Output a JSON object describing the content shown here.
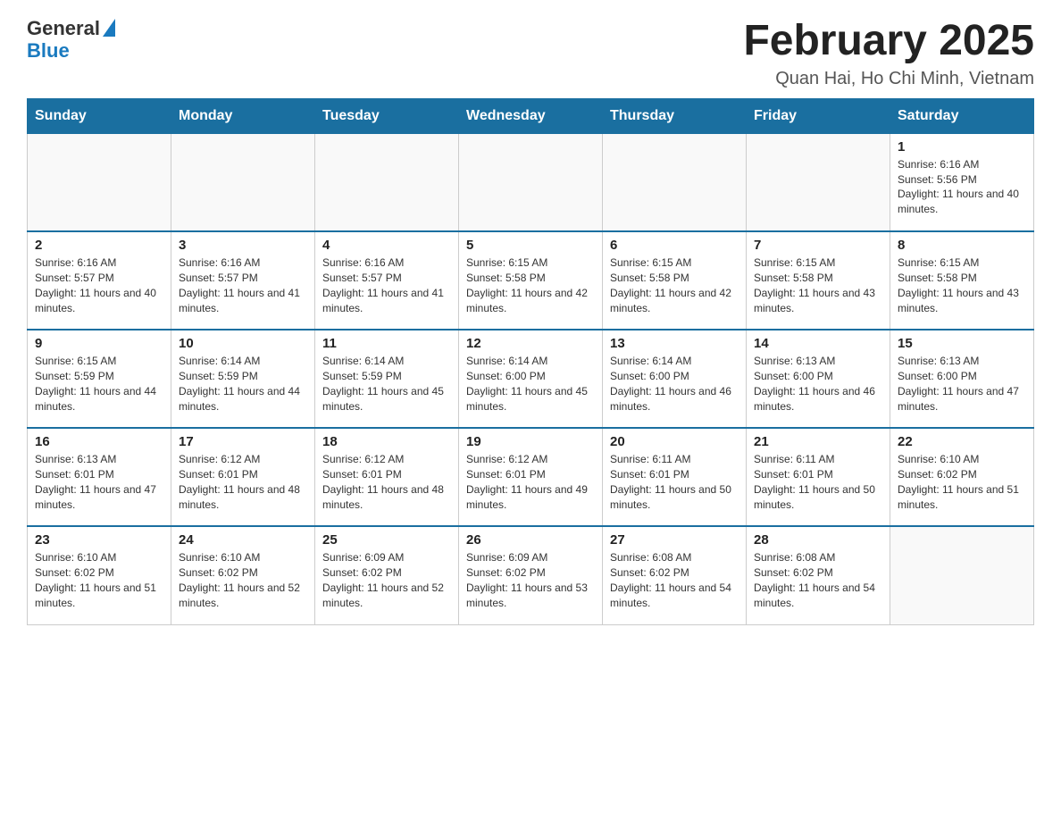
{
  "header": {
    "logo_general": "General",
    "logo_blue": "Blue",
    "title": "February 2025",
    "location": "Quan Hai, Ho Chi Minh, Vietnam"
  },
  "days_of_week": [
    "Sunday",
    "Monday",
    "Tuesday",
    "Wednesday",
    "Thursday",
    "Friday",
    "Saturday"
  ],
  "weeks": [
    [
      {
        "day": "",
        "info": ""
      },
      {
        "day": "",
        "info": ""
      },
      {
        "day": "",
        "info": ""
      },
      {
        "day": "",
        "info": ""
      },
      {
        "day": "",
        "info": ""
      },
      {
        "day": "",
        "info": ""
      },
      {
        "day": "1",
        "info": "Sunrise: 6:16 AM\nSunset: 5:56 PM\nDaylight: 11 hours and 40 minutes."
      }
    ],
    [
      {
        "day": "2",
        "info": "Sunrise: 6:16 AM\nSunset: 5:57 PM\nDaylight: 11 hours and 40 minutes."
      },
      {
        "day": "3",
        "info": "Sunrise: 6:16 AM\nSunset: 5:57 PM\nDaylight: 11 hours and 41 minutes."
      },
      {
        "day": "4",
        "info": "Sunrise: 6:16 AM\nSunset: 5:57 PM\nDaylight: 11 hours and 41 minutes."
      },
      {
        "day": "5",
        "info": "Sunrise: 6:15 AM\nSunset: 5:58 PM\nDaylight: 11 hours and 42 minutes."
      },
      {
        "day": "6",
        "info": "Sunrise: 6:15 AM\nSunset: 5:58 PM\nDaylight: 11 hours and 42 minutes."
      },
      {
        "day": "7",
        "info": "Sunrise: 6:15 AM\nSunset: 5:58 PM\nDaylight: 11 hours and 43 minutes."
      },
      {
        "day": "8",
        "info": "Sunrise: 6:15 AM\nSunset: 5:58 PM\nDaylight: 11 hours and 43 minutes."
      }
    ],
    [
      {
        "day": "9",
        "info": "Sunrise: 6:15 AM\nSunset: 5:59 PM\nDaylight: 11 hours and 44 minutes."
      },
      {
        "day": "10",
        "info": "Sunrise: 6:14 AM\nSunset: 5:59 PM\nDaylight: 11 hours and 44 minutes."
      },
      {
        "day": "11",
        "info": "Sunrise: 6:14 AM\nSunset: 5:59 PM\nDaylight: 11 hours and 45 minutes."
      },
      {
        "day": "12",
        "info": "Sunrise: 6:14 AM\nSunset: 6:00 PM\nDaylight: 11 hours and 45 minutes."
      },
      {
        "day": "13",
        "info": "Sunrise: 6:14 AM\nSunset: 6:00 PM\nDaylight: 11 hours and 46 minutes."
      },
      {
        "day": "14",
        "info": "Sunrise: 6:13 AM\nSunset: 6:00 PM\nDaylight: 11 hours and 46 minutes."
      },
      {
        "day": "15",
        "info": "Sunrise: 6:13 AM\nSunset: 6:00 PM\nDaylight: 11 hours and 47 minutes."
      }
    ],
    [
      {
        "day": "16",
        "info": "Sunrise: 6:13 AM\nSunset: 6:01 PM\nDaylight: 11 hours and 47 minutes."
      },
      {
        "day": "17",
        "info": "Sunrise: 6:12 AM\nSunset: 6:01 PM\nDaylight: 11 hours and 48 minutes."
      },
      {
        "day": "18",
        "info": "Sunrise: 6:12 AM\nSunset: 6:01 PM\nDaylight: 11 hours and 48 minutes."
      },
      {
        "day": "19",
        "info": "Sunrise: 6:12 AM\nSunset: 6:01 PM\nDaylight: 11 hours and 49 minutes."
      },
      {
        "day": "20",
        "info": "Sunrise: 6:11 AM\nSunset: 6:01 PM\nDaylight: 11 hours and 50 minutes."
      },
      {
        "day": "21",
        "info": "Sunrise: 6:11 AM\nSunset: 6:01 PM\nDaylight: 11 hours and 50 minutes."
      },
      {
        "day": "22",
        "info": "Sunrise: 6:10 AM\nSunset: 6:02 PM\nDaylight: 11 hours and 51 minutes."
      }
    ],
    [
      {
        "day": "23",
        "info": "Sunrise: 6:10 AM\nSunset: 6:02 PM\nDaylight: 11 hours and 51 minutes."
      },
      {
        "day": "24",
        "info": "Sunrise: 6:10 AM\nSunset: 6:02 PM\nDaylight: 11 hours and 52 minutes."
      },
      {
        "day": "25",
        "info": "Sunrise: 6:09 AM\nSunset: 6:02 PM\nDaylight: 11 hours and 52 minutes."
      },
      {
        "day": "26",
        "info": "Sunrise: 6:09 AM\nSunset: 6:02 PM\nDaylight: 11 hours and 53 minutes."
      },
      {
        "day": "27",
        "info": "Sunrise: 6:08 AM\nSunset: 6:02 PM\nDaylight: 11 hours and 54 minutes."
      },
      {
        "day": "28",
        "info": "Sunrise: 6:08 AM\nSunset: 6:02 PM\nDaylight: 11 hours and 54 minutes."
      },
      {
        "day": "",
        "info": ""
      }
    ]
  ]
}
